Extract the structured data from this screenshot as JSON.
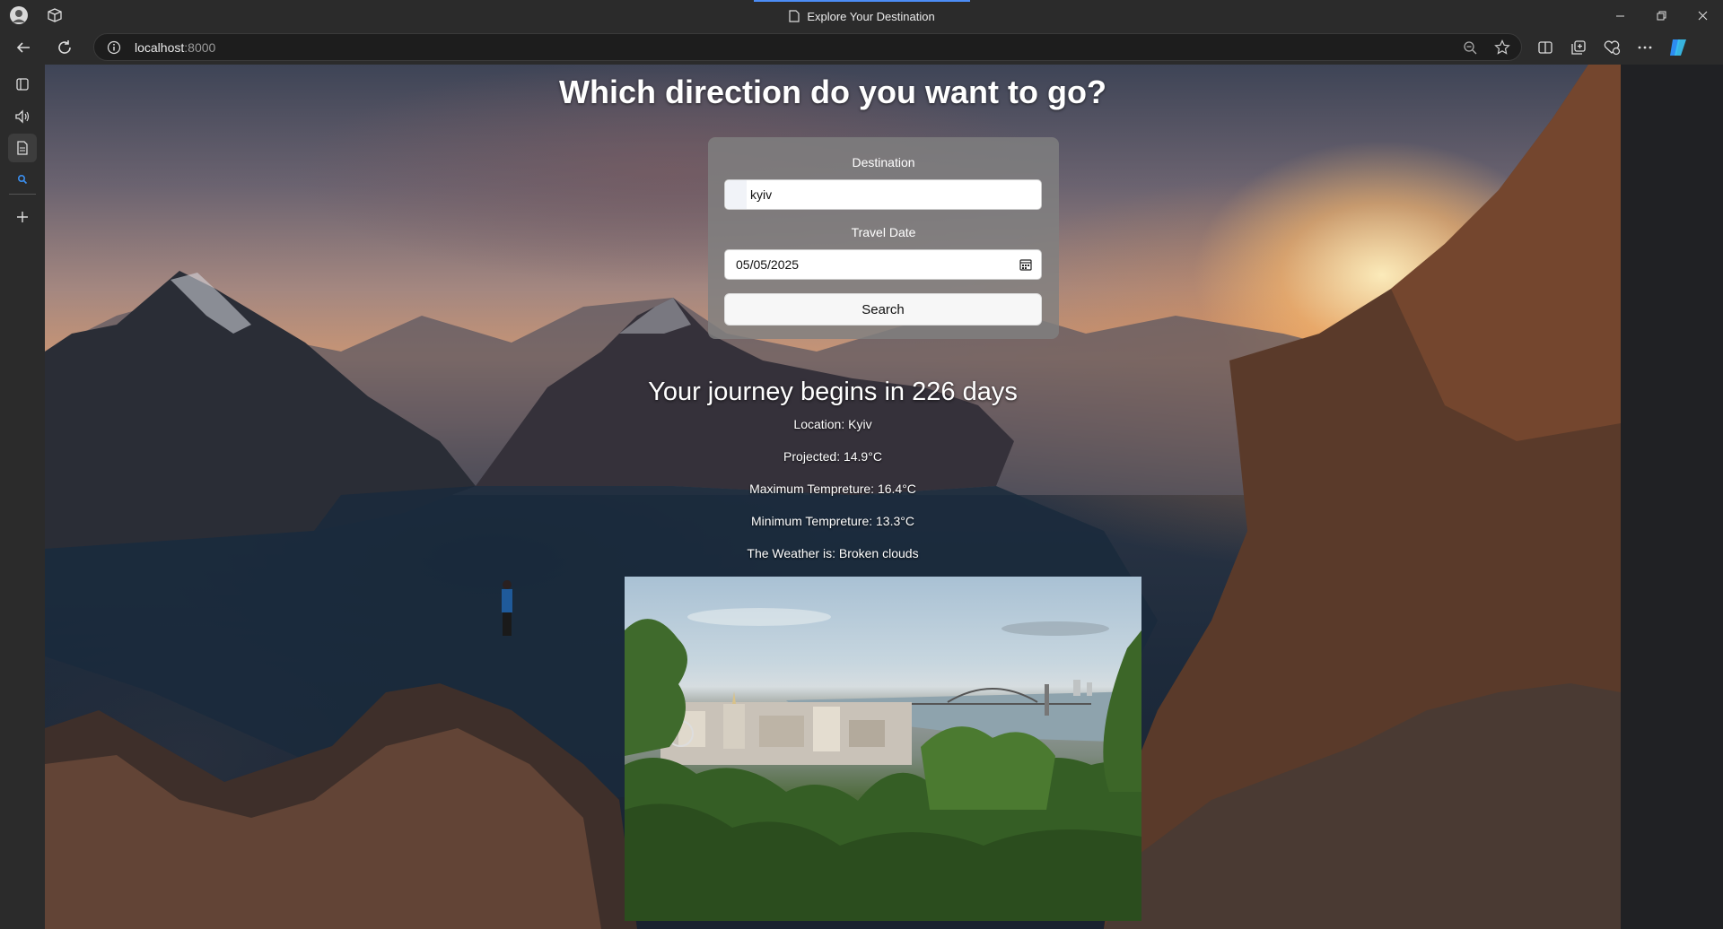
{
  "browser": {
    "tab_title": "Explore Your Destination",
    "url_host": "localhost",
    "url_port": ":8000"
  },
  "page": {
    "heading": "Which direction do you want to go?",
    "form": {
      "destination_label": "Destination",
      "destination_value": "kyiv",
      "date_label": "Travel Date",
      "date_value": "05/05/2025",
      "search_label": "Search"
    },
    "result": {
      "journey_text": "Your journey begins in 226 days",
      "location": "Location: Kyiv",
      "projected": "Projected: 14.9°C",
      "max_temp": "Maximum Tempreture: 16.4°C",
      "min_temp": "Minimum Tempreture: 13.3°C",
      "weather": "The Weather is: Broken clouds"
    }
  },
  "colors": {
    "accent_tab": "#4c8df6",
    "form_card": "#808080",
    "browser_chrome": "#2b2b2b"
  }
}
